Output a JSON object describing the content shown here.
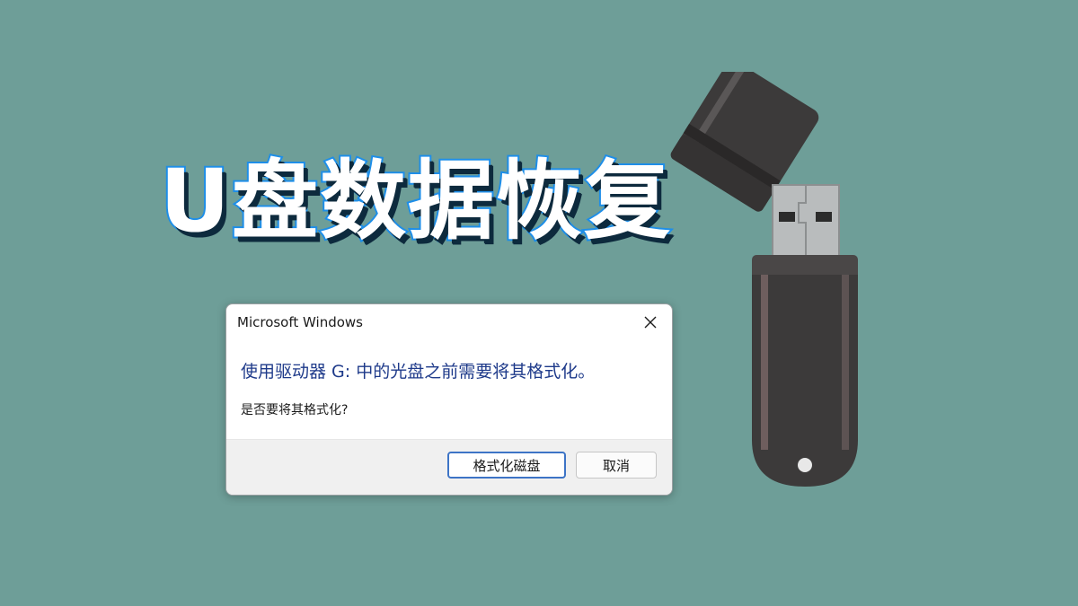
{
  "headline": "U盘数据恢复",
  "dialog": {
    "title": "Microsoft Windows",
    "main_instruction": "使用驱动器 G: 中的光盘之前需要将其格式化。",
    "content": "是否要将其格式化?",
    "format_button": "格式化磁盘",
    "cancel_button": "取消",
    "close_icon": "close-icon"
  },
  "illustration": {
    "icon": "usb-flash-drive-icon"
  },
  "colors": {
    "background": "#6e9e98",
    "headline_fill": "#ffffff",
    "headline_outline": "#1e8ee8",
    "instruction_text": "#1e3a8a",
    "primary_button_border": "#3d74c6"
  }
}
